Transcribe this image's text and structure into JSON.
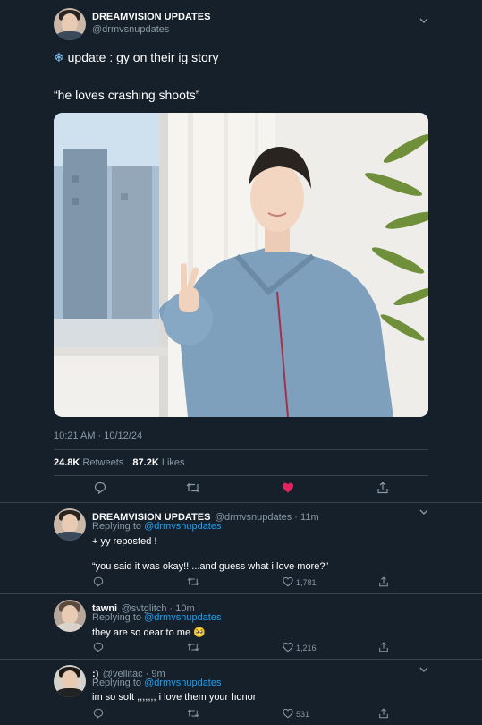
{
  "tweet": {
    "author": "DREAMVISION UPDATES",
    "handle": "@drmvsnupdates",
    "snowflake_icon": "❄",
    "text_line1": "update : gy on their ig story",
    "text_line2": "“he loves crashing shoots”",
    "time": "10:21 AM · 10/12/24",
    "retweets": "24.8K",
    "retweets_label": "Retweets",
    "likes": "87.2K",
    "likes_label": "Likes",
    "like_color": "#e0245e"
  },
  "replies": [
    {
      "author": "DREAMVISION UPDATES",
      "meta": "@drmvsnupdates · 11m",
      "replying_prefix": "Replying to",
      "replying_to": "@drmvsnupdates",
      "line1": "+ yy reposted !",
      "line2": "“you said it was okay!! ...and guess what i love more?”",
      "likes": "1,781"
    },
    {
      "author": "tawni",
      "meta": "@svtglitch · 10m",
      "replying_prefix": "Replying to",
      "replying_to": "@drmvsnupdates",
      "line1": "they are so dear to me 🥺",
      "likes": "1,216"
    },
    {
      "author": ":)",
      "meta": "@vellitac · 9m",
      "replying_prefix": "Replying to",
      "replying_to": "@drmvsnupdates",
      "line1": "im so soft ,,,,,,, i love them your honor",
      "likes": "531"
    }
  ],
  "colors": {
    "background": "#15202b",
    "secondary_text": "#8899a6",
    "link": "#1da1f2",
    "divider": "#38444d"
  }
}
